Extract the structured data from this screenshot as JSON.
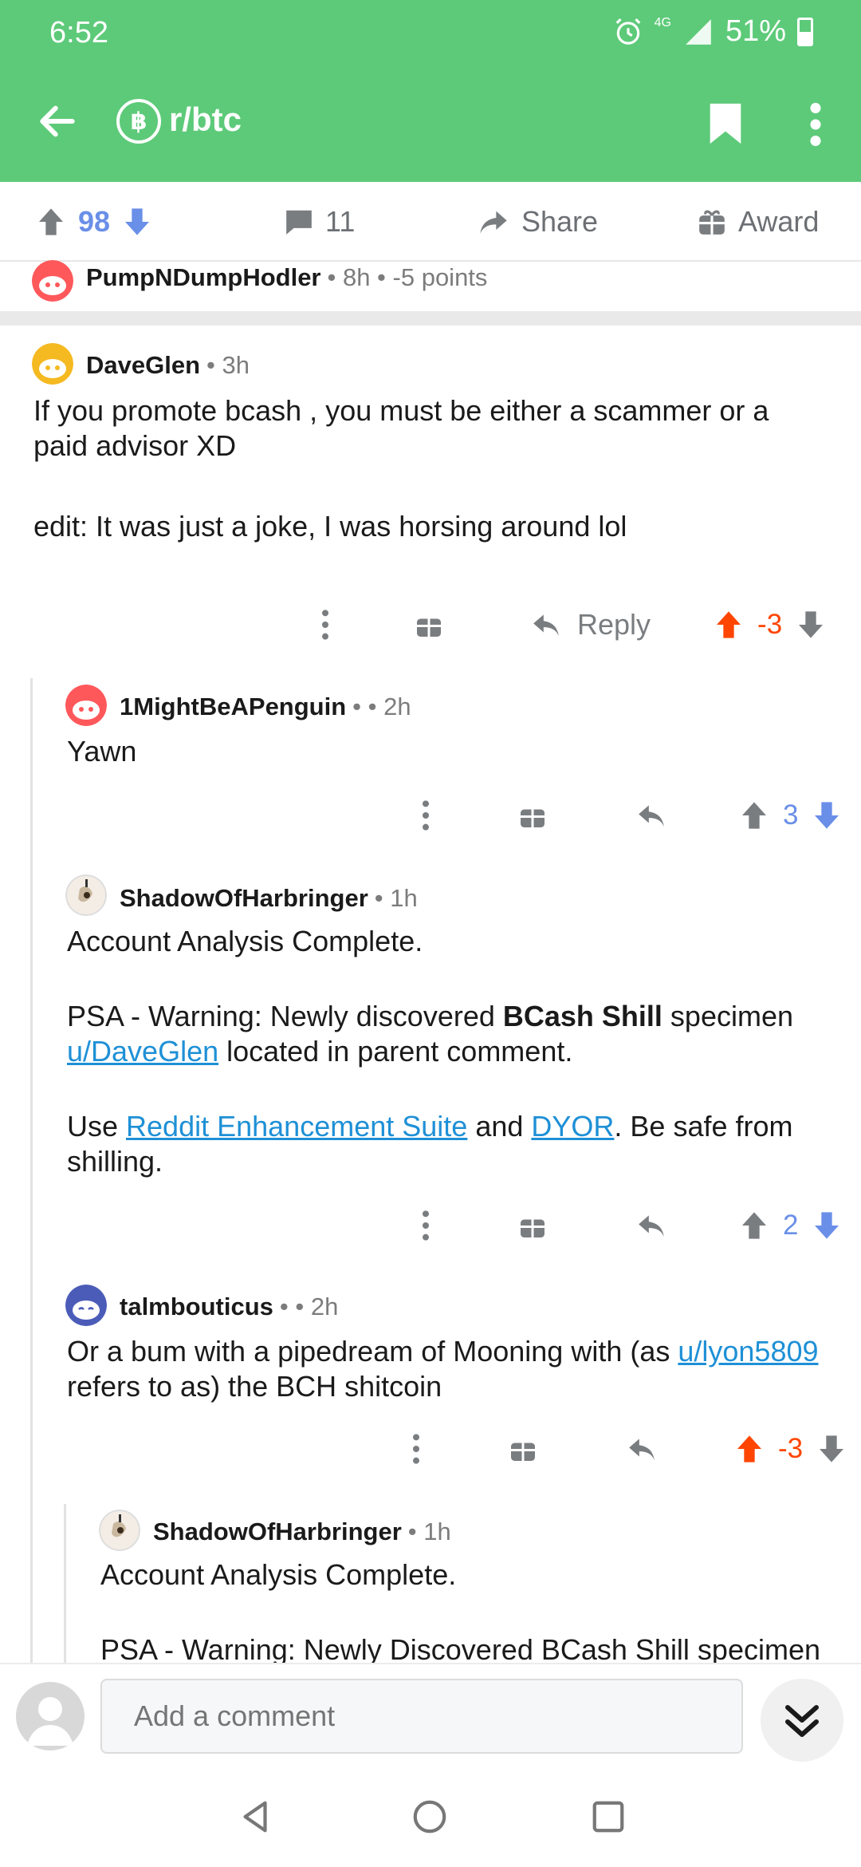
{
  "status_bar": {
    "time": "6:52",
    "network": "4G",
    "battery": "51%"
  },
  "app_bar": {
    "subreddit": "r/btc",
    "coin_symbol": "฿"
  },
  "post_actions": {
    "votes": "98",
    "comments": "11",
    "share_label": "Share",
    "award_label": "Award"
  },
  "collapsed_comment": {
    "author": "PumpNDumpHodler",
    "meta": "• 8h • -5 points"
  },
  "comments": [
    {
      "author": "DaveGlen",
      "meta": "• 3h",
      "lines": [
        "If you promote bcash , you must be either a scammer or a",
        "paid advisor XD"
      ],
      "edit": "edit: It was just a joke, I was horsing around lol",
      "reply_label": "Reply",
      "score": "-3"
    },
    {
      "author": "1MightBeAPenguin",
      "meta": "• • 2h",
      "text": "Yawn",
      "score": "3"
    },
    {
      "author": "ShadowOfHarbringer",
      "meta": "• 1h",
      "p1": "Account Analysis Complete.",
      "p2_a": "PSA - Warning: Newly discovered ",
      "p2_bold": "BCash Shill",
      "p2_b": " specimen ",
      "p2_link": "u/DaveGlen",
      "p2_c": " located in parent comment.",
      "p3_a": "Use ",
      "p3_link1": "Reddit Enhancement Suite",
      "p3_b": " and ",
      "p3_link2": "DYOR",
      "p3_c": ". Be safe from shilling.",
      "score": "2"
    },
    {
      "author": "talmbouticus",
      "meta": "• • 2h",
      "t_a": "Or a bum with a pipedream of Mooning with (as ",
      "t_link": "u/lyon5809",
      "t_b": " refers to as) the BCH shitcoin",
      "score": "-3"
    },
    {
      "author": "ShadowOfHarbringer",
      "meta": "• 1h",
      "p1": "Account Analysis Complete.",
      "p2": "PSA - Warning: Newly Discovered BCash Shill specimen"
    }
  ],
  "composer": {
    "placeholder": "Add a comment"
  },
  "colors": {
    "reddit_green": "#5dca79",
    "downvote_orange": "#ff4500",
    "upvote_blue": "#6a8fe8",
    "link": "#1e90d6"
  }
}
